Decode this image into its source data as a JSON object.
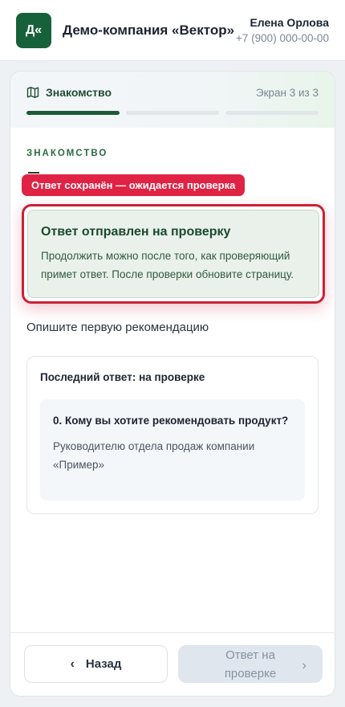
{
  "header": {
    "logo_text": "Д«",
    "company_name": "Демо-компания «Вектор»",
    "user_name": "Елена Орлова",
    "user_phone": "+7 (900) 000-00-00"
  },
  "steps": {
    "title": "Знакомство",
    "counter": "Экран 3 из 3",
    "icon": "map-icon",
    "progress_total": 3,
    "progress_done": 1
  },
  "section_label": "ЗНАКОМСТВО",
  "tooltip": "Ответ сохранён — ожидается проверка",
  "notice": {
    "title": "Ответ отправлен на проверку",
    "text": "Продолжить можно после того, как проверяющий примет ответ. После проверки обновите страницу."
  },
  "question_prompt": "Опишите первую рекомендацию",
  "last_answer": {
    "title": "Последний ответ: на проверке",
    "question": "0. Кому вы хотите рекомендовать продукт?",
    "answer": "Руководителю отдела продаж компании «Пример»"
  },
  "footer": {
    "back_label": "Назад",
    "next_label": "Ответ на проверке"
  },
  "colors": {
    "brand": "#17613a",
    "alert": "#e02244",
    "highlight_border": "#cc2036"
  }
}
